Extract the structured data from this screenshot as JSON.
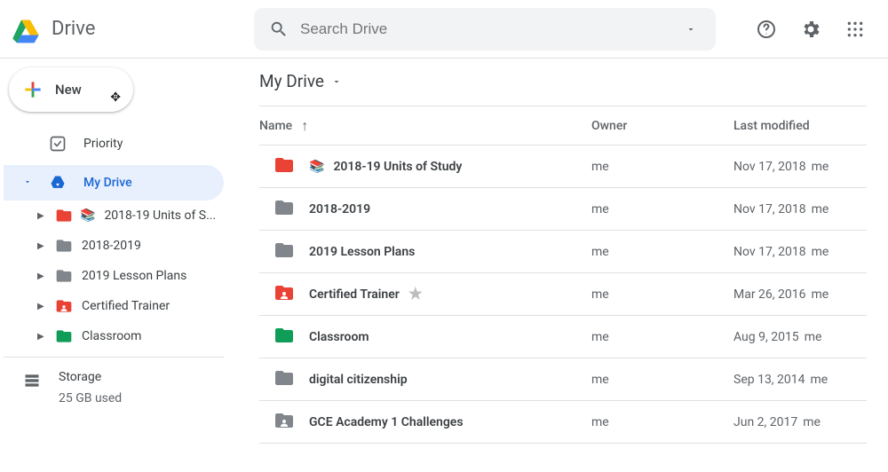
{
  "header": {
    "product_name": "Drive",
    "search_placeholder": "Search Drive"
  },
  "sidebar": {
    "new_label": "New",
    "priority_label": "Priority",
    "my_drive_label": "My Drive",
    "tree": [
      {
        "label": "2018-19 Units of S...",
        "color": "red",
        "has_book": true
      },
      {
        "label": "2018-2019",
        "color": "gray"
      },
      {
        "label": "2019 Lesson Plans",
        "color": "gray"
      },
      {
        "label": "Certified Trainer",
        "color": "red",
        "shared": true
      },
      {
        "label": "Classroom",
        "color": "green"
      }
    ],
    "storage_label": "Storage",
    "storage_used": "25 GB used"
  },
  "main": {
    "breadcrumb": "My Drive",
    "columns": {
      "name": "Name",
      "owner": "Owner",
      "modified": "Last modified"
    },
    "rows": [
      {
        "name": "2018-19 Units of Study",
        "owner": "me",
        "modified": "Nov 17, 2018",
        "mod_by": "me",
        "color": "red",
        "has_book": true
      },
      {
        "name": "2018-2019",
        "owner": "me",
        "modified": "Nov 17, 2018",
        "mod_by": "me",
        "color": "gray"
      },
      {
        "name": "2019 Lesson Plans",
        "owner": "me",
        "modified": "Nov 17, 2018",
        "mod_by": "me",
        "color": "gray"
      },
      {
        "name": "Certified Trainer",
        "owner": "me",
        "modified": "Mar 26, 2016",
        "mod_by": "me",
        "color": "red",
        "shared": true,
        "starred": true
      },
      {
        "name": "Classroom",
        "owner": "me",
        "modified": "Aug 9, 2015",
        "mod_by": "me",
        "color": "green"
      },
      {
        "name": "digital citizenship",
        "owner": "me",
        "modified": "Sep 13, 2014",
        "mod_by": "me",
        "color": "gray"
      },
      {
        "name": "GCE Academy 1 Challenges",
        "owner": "me",
        "modified": "Jun 2, 2017",
        "mod_by": "me",
        "color": "gray",
        "shared": true
      }
    ]
  }
}
